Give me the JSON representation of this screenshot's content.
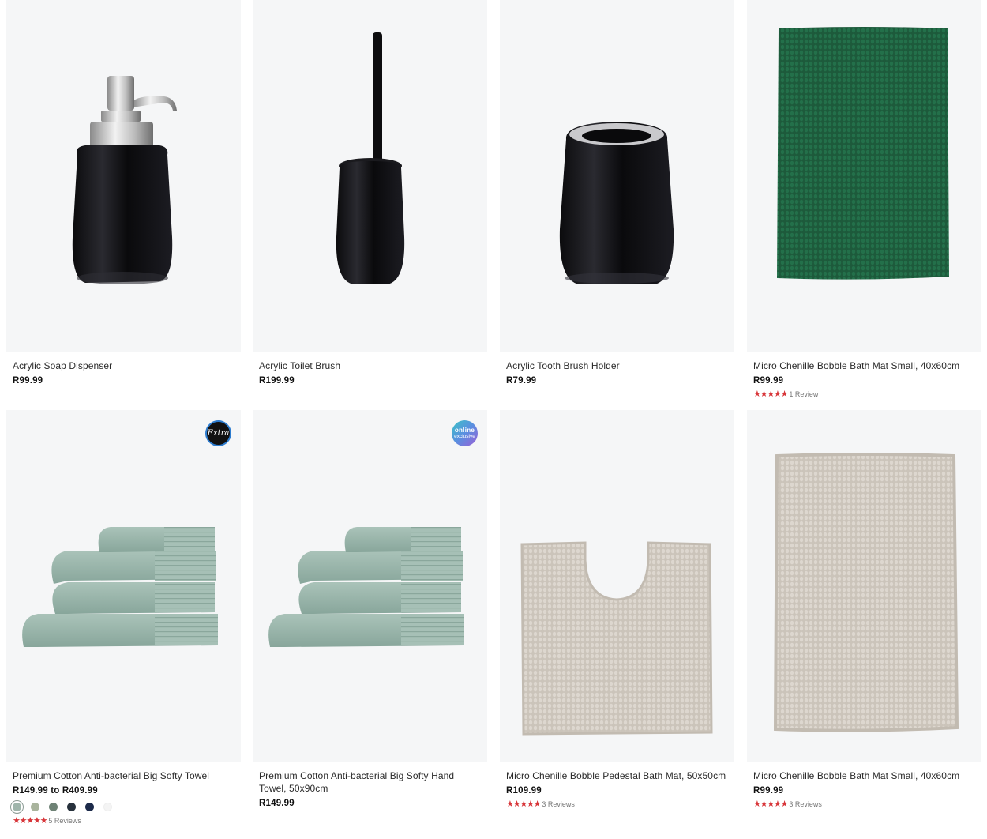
{
  "products": [
    {
      "title": "Acrylic Soap Dispenser",
      "price": "R99.99",
      "image": "soap-dispenser-image"
    },
    {
      "title": "Acrylic Toilet Brush",
      "price": "R199.99",
      "image": "toilet-brush-image"
    },
    {
      "title": "Acrylic Tooth Brush Holder",
      "price": "R79.99",
      "image": "tooth-brush-holder-image"
    },
    {
      "title": "Micro Chenille Bobble Bath Mat Small, 40x60cm",
      "price": "R99.99",
      "rating": 5,
      "stars": "★★★★★",
      "reviews": "1 Review",
      "image": "green-bath-mat-image"
    },
    {
      "title": "Premium Cotton Anti-bacterial Big Softy Towel",
      "price": "R149.99 to R409.99",
      "rating": 5,
      "stars": "★★★★★",
      "reviews": "5 Reviews",
      "badge": "Extra",
      "image": "towel-stack-image",
      "swatches": [
        "#9fb5ab",
        "#a9b49d",
        "#6e8275",
        "#27313c",
        "#1c2a4a",
        "#f4f4f4"
      ]
    },
    {
      "title": "Premium Cotton Anti-bacterial Big Softy Hand Towel, 50x90cm",
      "price": "R149.99",
      "badge_line1": "online",
      "badge_line2": "exclusive",
      "image": "hand-towel-stack-image"
    },
    {
      "title": "Micro Chenille Bobble Pedestal Bath Mat, 50x50cm",
      "price": "R109.99",
      "rating": 5,
      "stars": "★★★★★",
      "reviews": "3 Reviews",
      "image": "pedestal-mat-image"
    },
    {
      "title": "Micro Chenille Bobble Bath Mat Small, 40x60cm",
      "price": "R99.99",
      "rating": 5,
      "stars": "★★★★★",
      "reviews": "3 Reviews",
      "image": "beige-bath-mat-image"
    }
  ],
  "colors": {
    "star": "#d8363a",
    "image_bg": "#f5f6f7",
    "green_mat": "#1e5a3c",
    "beige_mat": "#d6d0c8",
    "towel": "#9fb8ae"
  }
}
